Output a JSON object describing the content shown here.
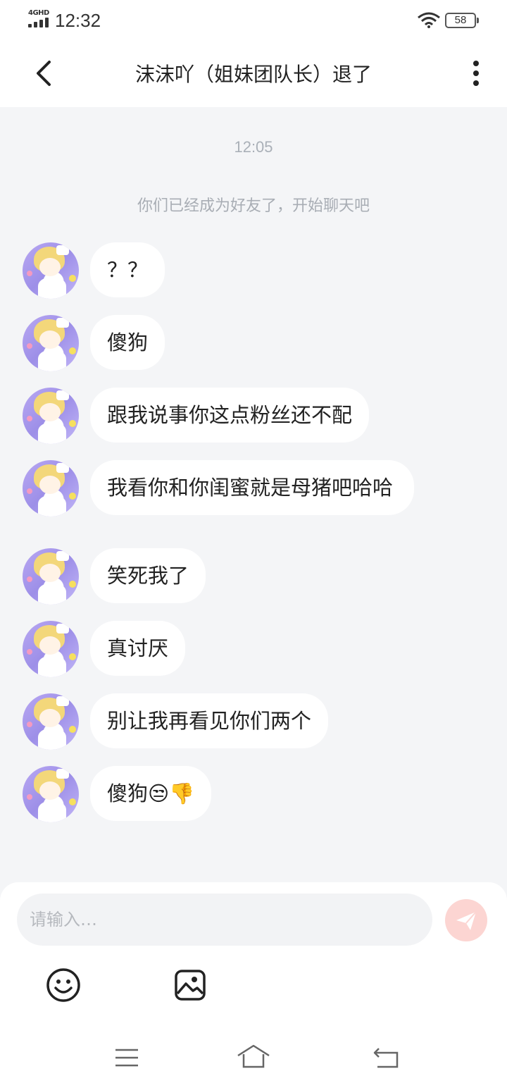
{
  "status_bar": {
    "network": "4GHD",
    "time": "12:32",
    "battery": "58"
  },
  "header": {
    "title": "沫沫吖（姐妹团队长）退了"
  },
  "chat": {
    "time_label": "12:05",
    "system_note": "你们已经成为好友了，开始聊天吧",
    "messages": [
      {
        "text": "？？"
      },
      {
        "text": "傻狗"
      },
      {
        "text": "跟我说事你这点粉丝还不配"
      },
      {
        "text": "我看你和你闺蜜就是母猪吧哈哈"
      },
      {
        "text": "笑死我了"
      },
      {
        "text": "真讨厌"
      },
      {
        "text": "别让我再看见你们两个"
      },
      {
        "text": "傻狗😒👎"
      }
    ]
  },
  "input": {
    "placeholder": "请输入…"
  },
  "icons": {
    "back": "chevron-left-icon",
    "more": "more-vertical-icon",
    "send": "paper-plane-icon",
    "emoji": "smiley-icon",
    "image": "image-icon",
    "nav_menu": "menu-icon",
    "nav_home": "home-icon",
    "nav_back": "return-icon"
  },
  "colors": {
    "background": "#f4f5f7",
    "bubble": "#ffffff",
    "send_button": "#fcd5d2",
    "muted_text": "#aab0b8"
  }
}
